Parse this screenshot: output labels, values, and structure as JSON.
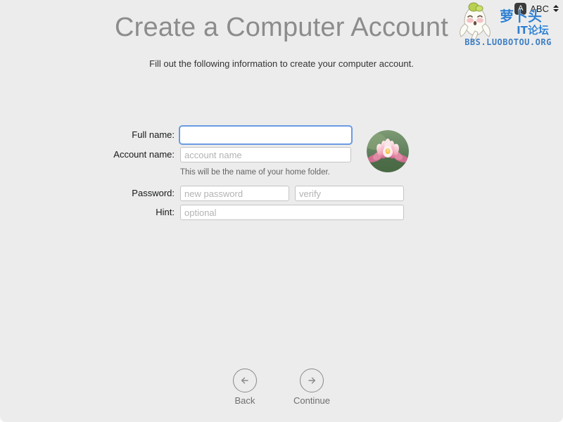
{
  "window": {
    "background_color": "#ececec"
  },
  "header": {
    "title": "Create a Computer Account",
    "subtitle": "Fill out the following information to create your computer account.",
    "title_color": "#8c8c8c"
  },
  "menu_bar": {
    "input_source": {
      "glyph": "A",
      "label": "ABC",
      "icon": "keyboard-input-source-icon",
      "chevron": "chevron-up-down-icon"
    }
  },
  "watermark": {
    "mascot": "radish-mascot-icon",
    "brand_main": "萝卜头",
    "brand_sub": "IT论坛",
    "url": "BBS.LUOBOTOU.ORG",
    "brand_color": "#2f7fd0",
    "url_color": "#3f7fc4"
  },
  "form": {
    "fields": [
      {
        "id": "fullname",
        "label": "Full name:",
        "value": "",
        "placeholder": "",
        "focused": true,
        "type": "text"
      },
      {
        "id": "accountname",
        "label": "Account name:",
        "value": "",
        "placeholder": "account name",
        "focused": false,
        "type": "text"
      },
      {
        "id": "password",
        "label": "Password:",
        "value": "",
        "placeholder": "new password",
        "focused": false,
        "type": "password"
      },
      {
        "id": "verify",
        "label": "",
        "value": "",
        "placeholder": "verify",
        "focused": false,
        "type": "password"
      },
      {
        "id": "hint",
        "label": "Hint:",
        "value": "",
        "placeholder": "optional",
        "focused": false,
        "type": "text"
      }
    ],
    "helper_text": "This will be the name of your home folder.",
    "focus_ring_color": "#6b9ae4"
  },
  "avatar": {
    "name": "user-picture-lotus",
    "description": "lotus-flower-avatar"
  },
  "navigation": {
    "back": {
      "label": "Back",
      "icon": "arrow-left-circle-icon"
    },
    "continue": {
      "label": "Continue",
      "icon": "arrow-right-circle-icon"
    }
  }
}
